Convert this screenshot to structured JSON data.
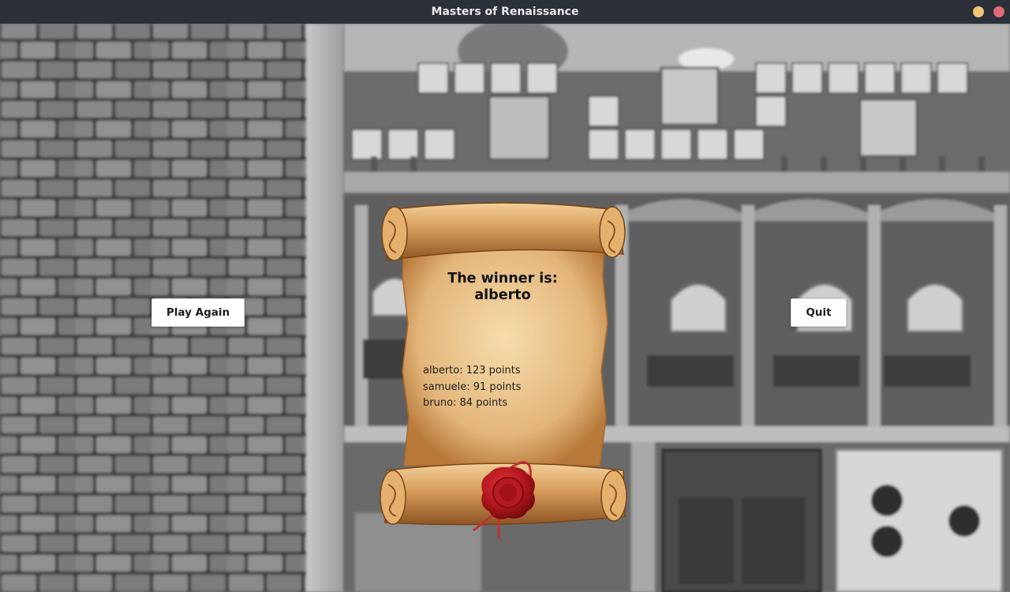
{
  "window": {
    "title": "Masters of Renaissance"
  },
  "buttons": {
    "play_again": "Play Again",
    "quit": "Quit"
  },
  "scroll": {
    "winner_heading": "The winner is:",
    "winner_name": "alberto",
    "scores": [
      "alberto: 123 points",
      "samuele: 91 points",
      "bruno: 84 points"
    ]
  },
  "colors": {
    "titlebar": "#2c3039",
    "minimize": "#f0c674",
    "close": "#e06c75",
    "parchment": "#d9a96a",
    "wax_seal": "#b0161c"
  }
}
